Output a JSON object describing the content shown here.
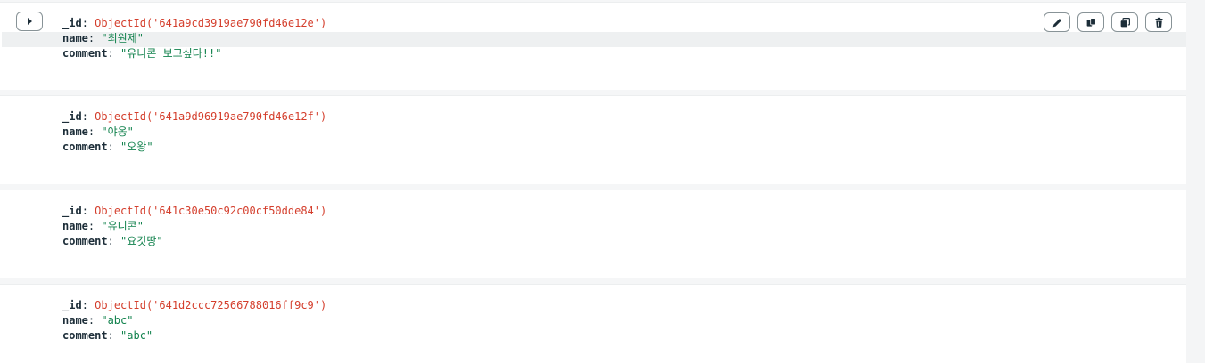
{
  "documents": [
    {
      "id_key": "_id",
      "id_value": "ObjectId('641a9cd3919ae790fd46e12e')",
      "name_key": "name",
      "name_value": "\"최원제\"",
      "comment_key": "comment",
      "comment_value": "\"유니콘 보고싶다!!\""
    },
    {
      "id_key": "_id",
      "id_value": "ObjectId('641a9d96919ae790fd46e12f')",
      "name_key": "name",
      "name_value": "\"야옹\"",
      "comment_key": "comment",
      "comment_value": "\"오왕\""
    },
    {
      "id_key": "_id",
      "id_value": "ObjectId('641c30e50c92c00cf50dde84')",
      "name_key": "name",
      "name_value": "\"유니콘\"",
      "comment_key": "comment",
      "comment_value": "\"요깃땅\""
    },
    {
      "id_key": "_id",
      "id_value": "ObjectId('641d2ccc72566788016ff9c9')",
      "name_key": "name",
      "name_value": "\"abc\"",
      "comment_key": "comment",
      "comment_value": "\"abc\""
    }
  ],
  "actions": {
    "edit_icon": "pencil-icon",
    "copy_icon": "copy-icon",
    "clone_icon": "clone-icon",
    "delete_icon": "trash-icon"
  },
  "colors": {
    "object_id": "#d43e2c",
    "string": "#12824d",
    "key": "#1c2d38"
  }
}
